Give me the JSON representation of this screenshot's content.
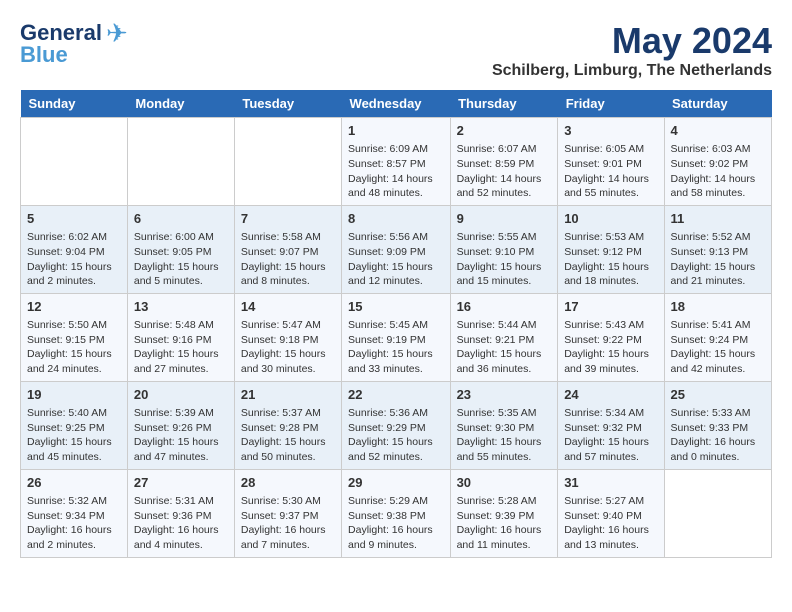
{
  "logo": {
    "line1": "General",
    "line2": "Blue"
  },
  "title": "May 2024",
  "subtitle": "Schilberg, Limburg, The Netherlands",
  "days_header": [
    "Sunday",
    "Monday",
    "Tuesday",
    "Wednesday",
    "Thursday",
    "Friday",
    "Saturday"
  ],
  "weeks": [
    [
      {
        "day": "",
        "info": ""
      },
      {
        "day": "",
        "info": ""
      },
      {
        "day": "",
        "info": ""
      },
      {
        "day": "1",
        "info": "Sunrise: 6:09 AM\nSunset: 8:57 PM\nDaylight: 14 hours and 48 minutes."
      },
      {
        "day": "2",
        "info": "Sunrise: 6:07 AM\nSunset: 8:59 PM\nDaylight: 14 hours and 52 minutes."
      },
      {
        "day": "3",
        "info": "Sunrise: 6:05 AM\nSunset: 9:01 PM\nDaylight: 14 hours and 55 minutes."
      },
      {
        "day": "4",
        "info": "Sunrise: 6:03 AM\nSunset: 9:02 PM\nDaylight: 14 hours and 58 minutes."
      }
    ],
    [
      {
        "day": "5",
        "info": "Sunrise: 6:02 AM\nSunset: 9:04 PM\nDaylight: 15 hours and 2 minutes."
      },
      {
        "day": "6",
        "info": "Sunrise: 6:00 AM\nSunset: 9:05 PM\nDaylight: 15 hours and 5 minutes."
      },
      {
        "day": "7",
        "info": "Sunrise: 5:58 AM\nSunset: 9:07 PM\nDaylight: 15 hours and 8 minutes."
      },
      {
        "day": "8",
        "info": "Sunrise: 5:56 AM\nSunset: 9:09 PM\nDaylight: 15 hours and 12 minutes."
      },
      {
        "day": "9",
        "info": "Sunrise: 5:55 AM\nSunset: 9:10 PM\nDaylight: 15 hours and 15 minutes."
      },
      {
        "day": "10",
        "info": "Sunrise: 5:53 AM\nSunset: 9:12 PM\nDaylight: 15 hours and 18 minutes."
      },
      {
        "day": "11",
        "info": "Sunrise: 5:52 AM\nSunset: 9:13 PM\nDaylight: 15 hours and 21 minutes."
      }
    ],
    [
      {
        "day": "12",
        "info": "Sunrise: 5:50 AM\nSunset: 9:15 PM\nDaylight: 15 hours and 24 minutes."
      },
      {
        "day": "13",
        "info": "Sunrise: 5:48 AM\nSunset: 9:16 PM\nDaylight: 15 hours and 27 minutes."
      },
      {
        "day": "14",
        "info": "Sunrise: 5:47 AM\nSunset: 9:18 PM\nDaylight: 15 hours and 30 minutes."
      },
      {
        "day": "15",
        "info": "Sunrise: 5:45 AM\nSunset: 9:19 PM\nDaylight: 15 hours and 33 minutes."
      },
      {
        "day": "16",
        "info": "Sunrise: 5:44 AM\nSunset: 9:21 PM\nDaylight: 15 hours and 36 minutes."
      },
      {
        "day": "17",
        "info": "Sunrise: 5:43 AM\nSunset: 9:22 PM\nDaylight: 15 hours and 39 minutes."
      },
      {
        "day": "18",
        "info": "Sunrise: 5:41 AM\nSunset: 9:24 PM\nDaylight: 15 hours and 42 minutes."
      }
    ],
    [
      {
        "day": "19",
        "info": "Sunrise: 5:40 AM\nSunset: 9:25 PM\nDaylight: 15 hours and 45 minutes."
      },
      {
        "day": "20",
        "info": "Sunrise: 5:39 AM\nSunset: 9:26 PM\nDaylight: 15 hours and 47 minutes."
      },
      {
        "day": "21",
        "info": "Sunrise: 5:37 AM\nSunset: 9:28 PM\nDaylight: 15 hours and 50 minutes."
      },
      {
        "day": "22",
        "info": "Sunrise: 5:36 AM\nSunset: 9:29 PM\nDaylight: 15 hours and 52 minutes."
      },
      {
        "day": "23",
        "info": "Sunrise: 5:35 AM\nSunset: 9:30 PM\nDaylight: 15 hours and 55 minutes."
      },
      {
        "day": "24",
        "info": "Sunrise: 5:34 AM\nSunset: 9:32 PM\nDaylight: 15 hours and 57 minutes."
      },
      {
        "day": "25",
        "info": "Sunrise: 5:33 AM\nSunset: 9:33 PM\nDaylight: 16 hours and 0 minutes."
      }
    ],
    [
      {
        "day": "26",
        "info": "Sunrise: 5:32 AM\nSunset: 9:34 PM\nDaylight: 16 hours and 2 minutes."
      },
      {
        "day": "27",
        "info": "Sunrise: 5:31 AM\nSunset: 9:36 PM\nDaylight: 16 hours and 4 minutes."
      },
      {
        "day": "28",
        "info": "Sunrise: 5:30 AM\nSunset: 9:37 PM\nDaylight: 16 hours and 7 minutes."
      },
      {
        "day": "29",
        "info": "Sunrise: 5:29 AM\nSunset: 9:38 PM\nDaylight: 16 hours and 9 minutes."
      },
      {
        "day": "30",
        "info": "Sunrise: 5:28 AM\nSunset: 9:39 PM\nDaylight: 16 hours and 11 minutes."
      },
      {
        "day": "31",
        "info": "Sunrise: 5:27 AM\nSunset: 9:40 PM\nDaylight: 16 hours and 13 minutes."
      },
      {
        "day": "",
        "info": ""
      }
    ]
  ]
}
